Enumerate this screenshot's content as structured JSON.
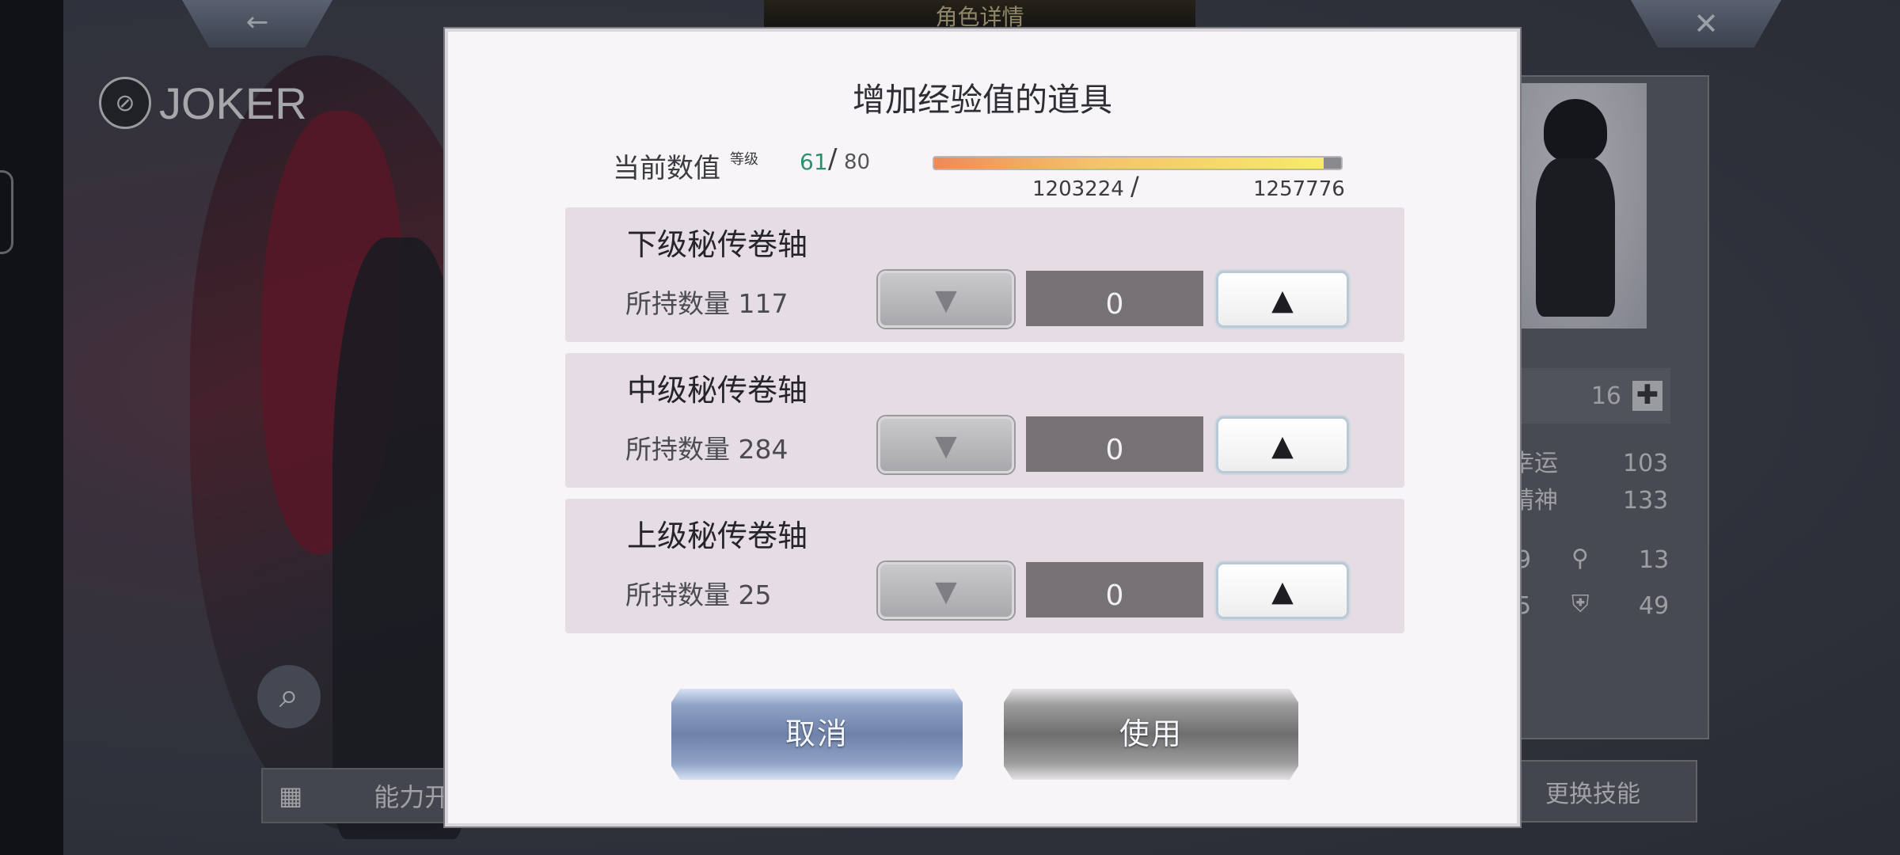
{
  "background": {
    "header_title": "角色详情",
    "back_icon": "←",
    "close_icon": "✕",
    "character_name": "JOKER",
    "search_icon": "⌕",
    "ability_button_label": "能力开",
    "swap_skill_label": "更换技能",
    "level_value": "16",
    "plus_icon": "✚",
    "stats": [
      {
        "label": "幸运",
        "value": "103"
      },
      {
        "label": "精神",
        "value": "133"
      },
      {
        "label": "9",
        "value": "13"
      },
      {
        "label": "5",
        "value": "49"
      }
    ]
  },
  "dialog": {
    "title": "增加经验值的道具",
    "current_label": "当前数值",
    "level_label": "等级",
    "level_current": "61",
    "level_max": "80",
    "exp_current": "1203224",
    "exp_max": "1257776",
    "exp_progress_fraction": 0.957,
    "items": [
      {
        "name": "下级秘传卷轴",
        "count_label": "所持数量 117",
        "quantity": "0"
      },
      {
        "name": "中级秘传卷轴",
        "count_label": "所持数量 284",
        "quantity": "0"
      },
      {
        "name": "上级秘传卷轴",
        "count_label": "所持数量 25",
        "quantity": "0"
      }
    ],
    "down_icon": "▼",
    "up_icon": "▲",
    "cancel_label": "取消",
    "use_label": "使用"
  }
}
